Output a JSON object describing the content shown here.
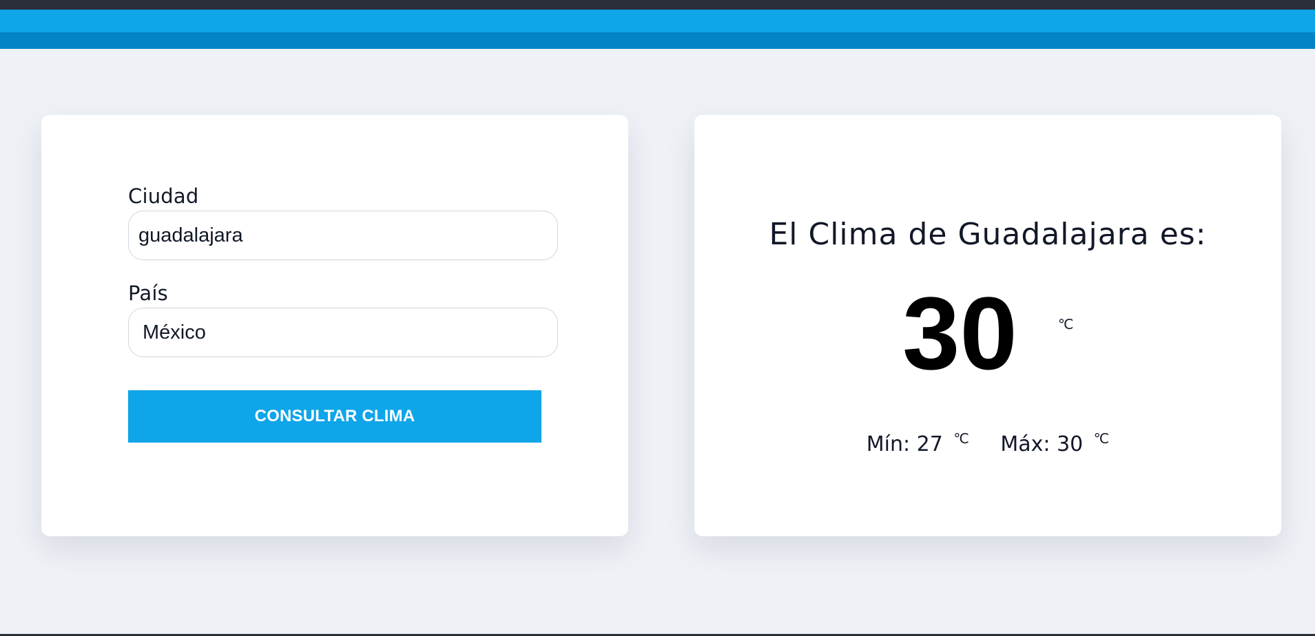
{
  "form": {
    "city_label": "Ciudad",
    "city_value": "guadalajara",
    "country_label": "País",
    "country_value": "México",
    "submit_label": "CONSULTAR CLIMA"
  },
  "result": {
    "title": "El Clima de Guadalajara es:",
    "temperature": "30",
    "unit": "℃",
    "min_label": "Mín:",
    "min_value": "27",
    "max_label": "Máx:",
    "max_value": "30",
    "minmax_unit": "℃"
  },
  "colors": {
    "page_background": "#eef2f7",
    "primary": "#0ea5e9",
    "primary_dark": "#0284c7",
    "text": "#111827"
  }
}
